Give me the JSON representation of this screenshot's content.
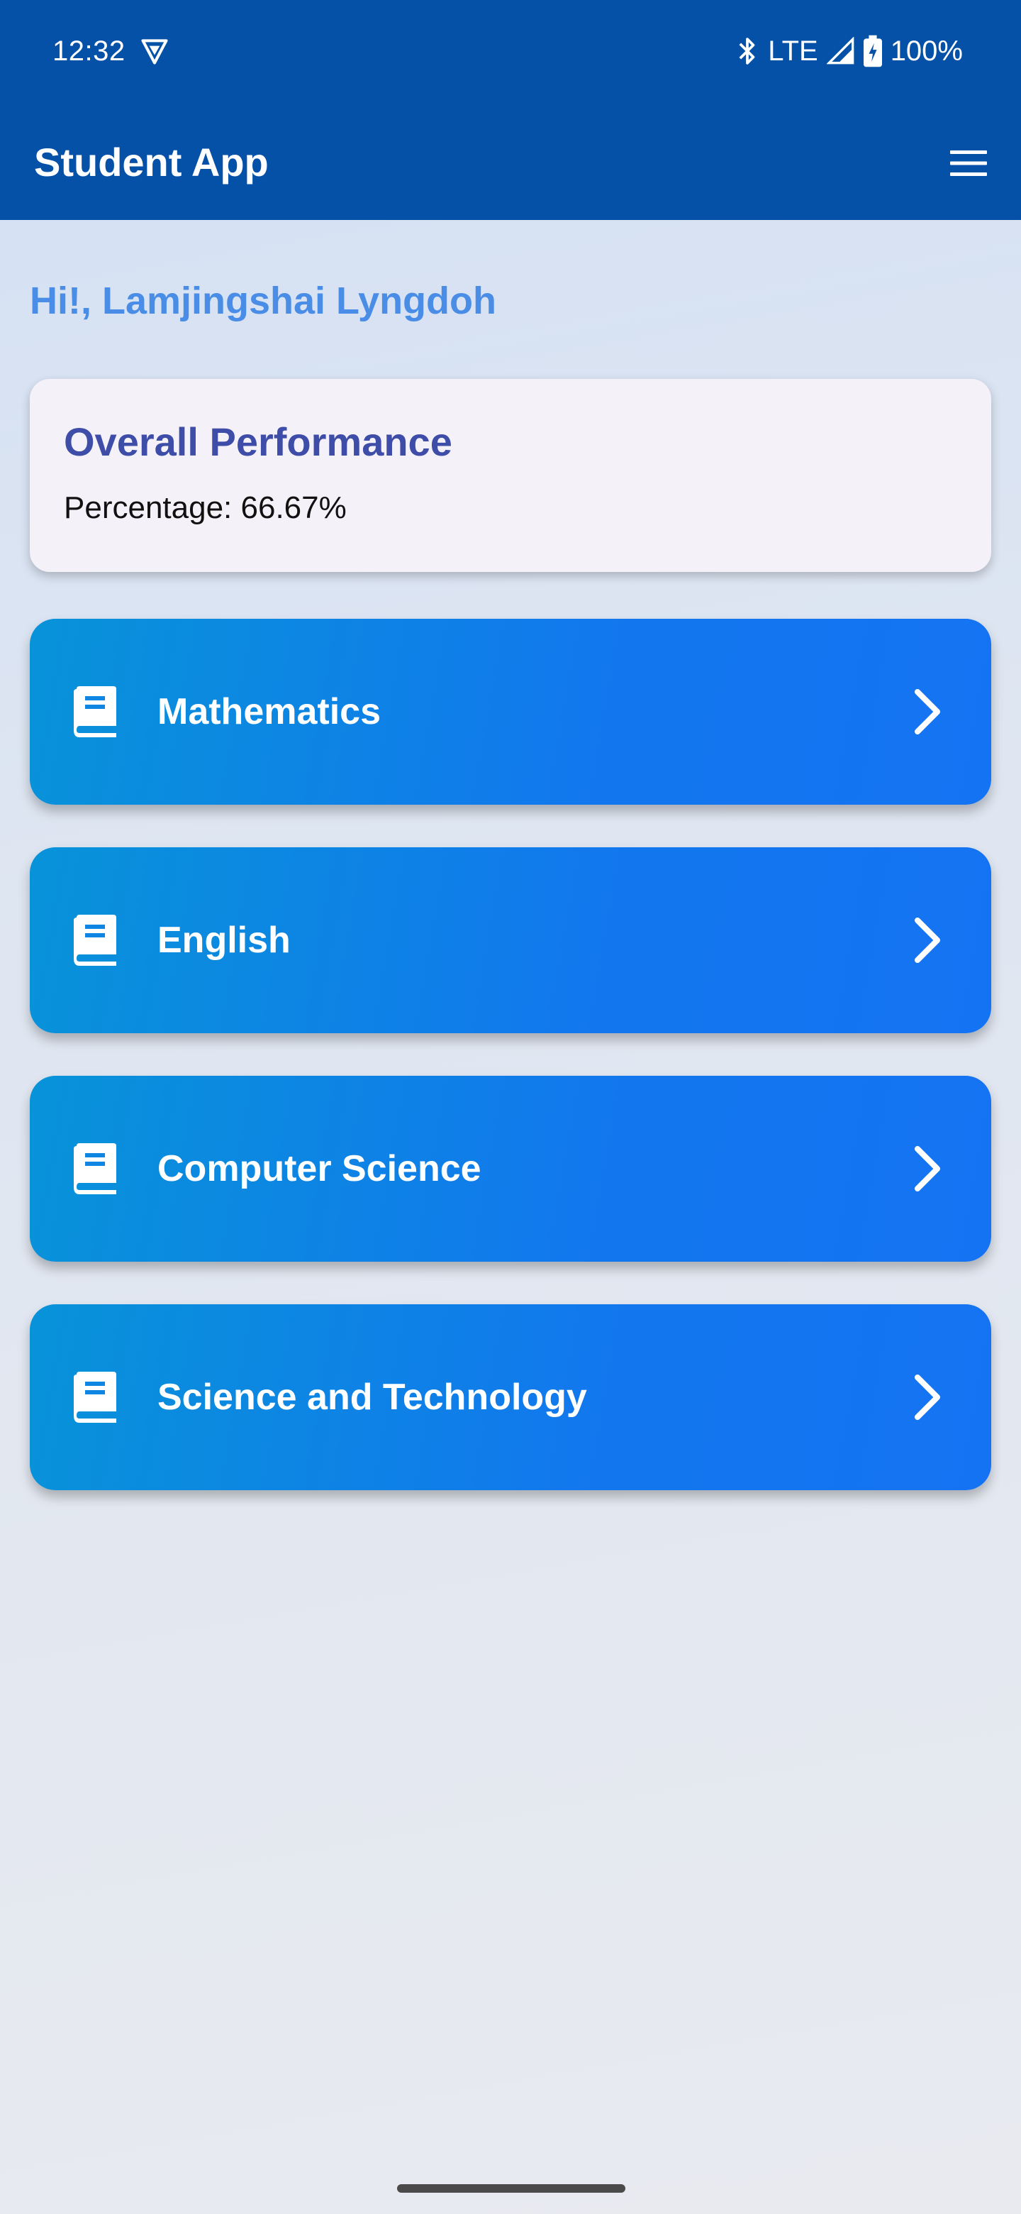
{
  "status_bar": {
    "time": "12:32",
    "network": "LTE",
    "battery": "100%",
    "icons": [
      "vpn-icon",
      "bluetooth-icon",
      "signal-icon",
      "battery-charging-icon"
    ]
  },
  "app_bar": {
    "title": "Student App",
    "menu_icon": "hamburger-menu-icon"
  },
  "greeting": "Hi!, Lamjingshai Lyngdoh",
  "performance": {
    "title": "Overall Performance",
    "percentage_line": "Percentage: 66.67%"
  },
  "subjects": [
    {
      "label": "Mathematics",
      "icon": "book-icon"
    },
    {
      "label": "English",
      "icon": "book-icon"
    },
    {
      "label": "Computer Science",
      "icon": "book-icon"
    },
    {
      "label": "Science and Technology",
      "icon": "book-icon"
    }
  ],
  "colors": {
    "app_bar": "#0651a8",
    "greeting": "#4a8de6",
    "card_title": "#3d4da8",
    "subject_gradient_start": "#0893d9",
    "subject_gradient_end": "#1473f3"
  }
}
